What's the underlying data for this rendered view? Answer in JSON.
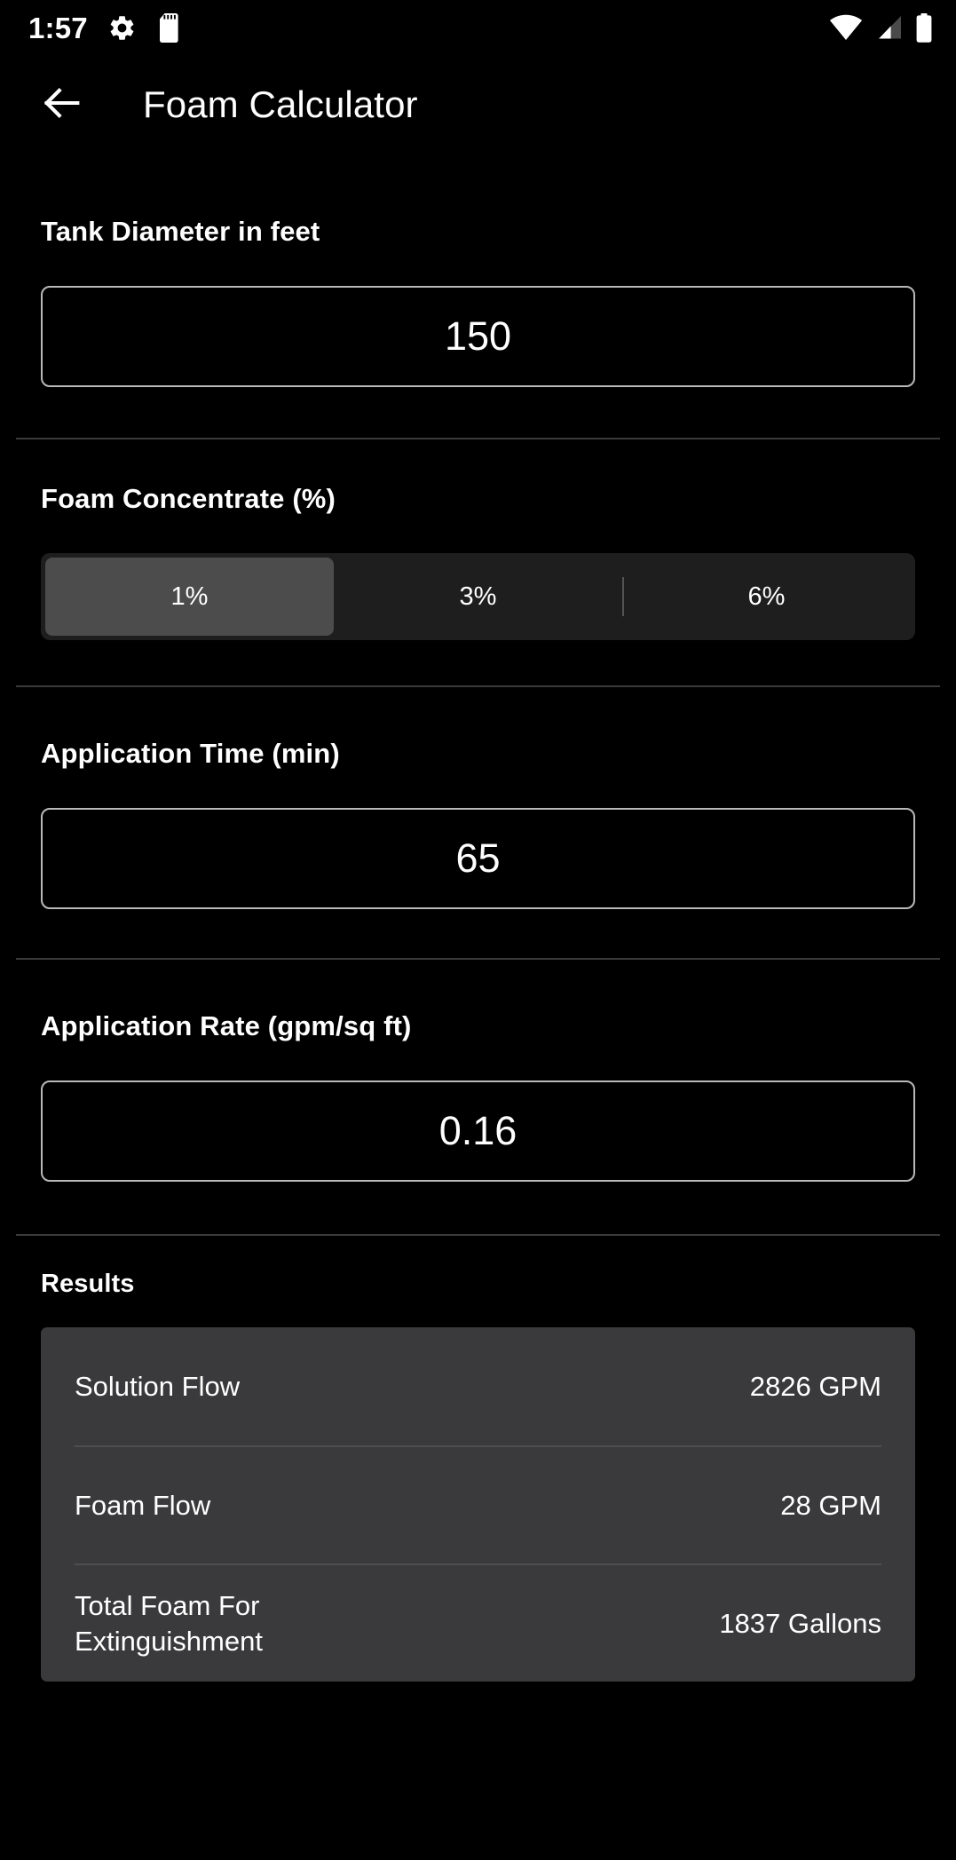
{
  "status_bar": {
    "time": "1:57",
    "icons": [
      "gear-icon",
      "sd-card-icon",
      "wifi-icon",
      "cell-signal-icon",
      "battery-icon"
    ]
  },
  "app_bar": {
    "back_icon": "back-arrow-icon",
    "title": "Foam Calculator"
  },
  "fields": {
    "tank_diameter": {
      "label": "Tank Diameter in feet",
      "value": "150",
      "placeholder": ""
    },
    "foam_concentrate": {
      "label": "Foam Concentrate (%)",
      "options": [
        "1%",
        "3%",
        "6%"
      ],
      "selected": "1%",
      "selected_index": 0
    },
    "application_time": {
      "label": "Application Time (min)",
      "value": "65",
      "placeholder": ""
    },
    "application_rate": {
      "label": "Application Rate (gpm/sq ft)",
      "value": "0.16",
      "placeholder": ""
    }
  },
  "results": {
    "title": "Results",
    "rows": [
      {
        "label": "Solution Flow",
        "value": "2826 GPM"
      },
      {
        "label": "Foam Flow",
        "value": "28 GPM"
      },
      {
        "label": "Total Foam For Extinguishment",
        "value": "1837 Gallons"
      }
    ]
  },
  "colors": {
    "background": "#000000",
    "text": "#ffffff",
    "input_border": "#b9b9b9",
    "divider": "#3a3a3a",
    "segment_track": "#1e1e1e",
    "segment_selected": "#4c4c4c",
    "results_card": "#3a3a3c",
    "results_divider": "#4e4e50"
  }
}
